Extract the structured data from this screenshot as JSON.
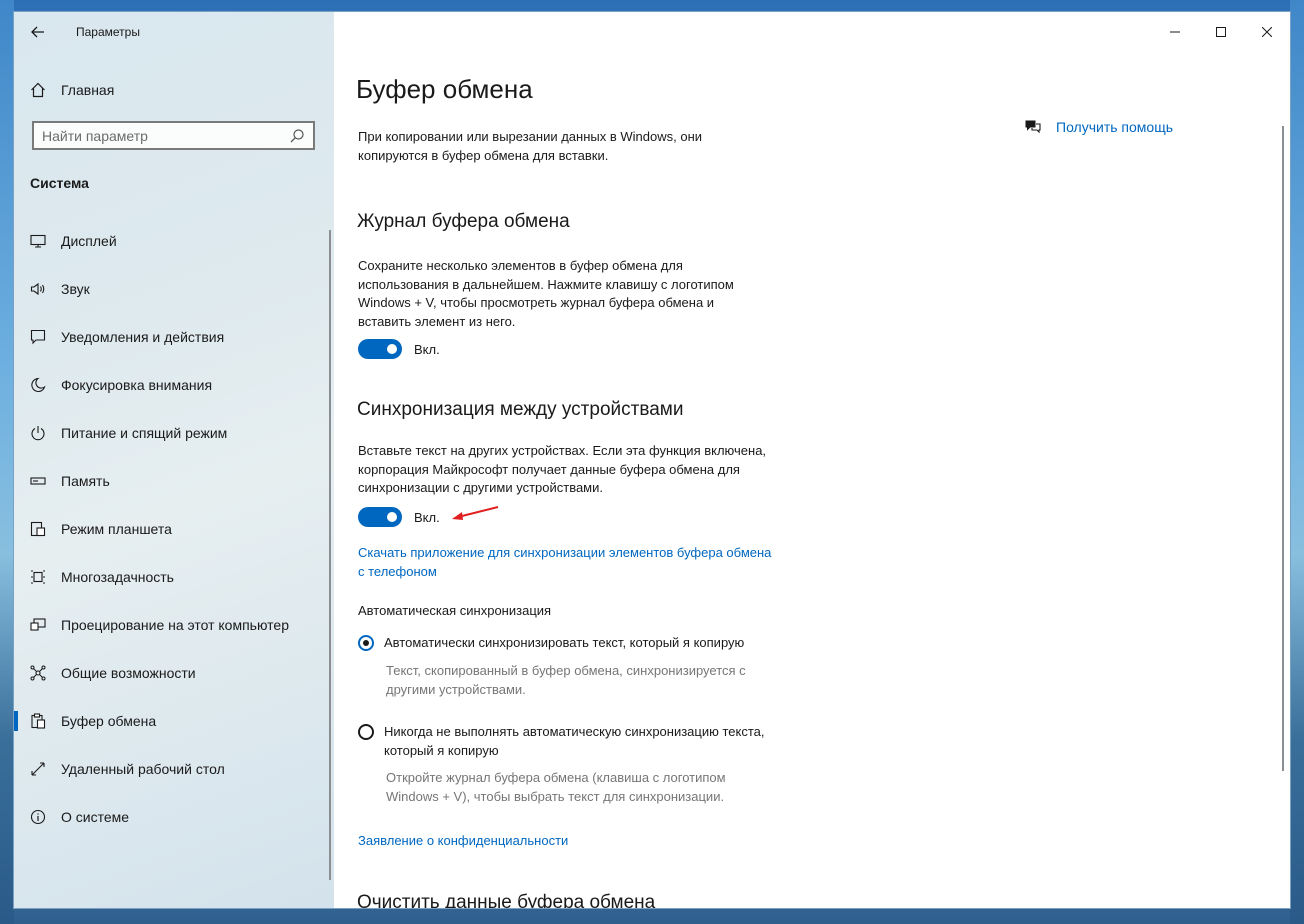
{
  "app": {
    "title": "Параметры"
  },
  "sidebar": {
    "home_label": "Главная",
    "search_placeholder": "Найти параметр",
    "section_label": "Система",
    "items": [
      {
        "label": "Дисплей",
        "icon": "display-icon"
      },
      {
        "label": "Звук",
        "icon": "speaker-icon"
      },
      {
        "label": "Уведомления и действия",
        "icon": "notification-icon"
      },
      {
        "label": "Фокусировка внимания",
        "icon": "moon-icon"
      },
      {
        "label": "Питание и спящий режим",
        "icon": "power-icon"
      },
      {
        "label": "Память",
        "icon": "storage-icon"
      },
      {
        "label": "Режим планшета",
        "icon": "tablet-icon"
      },
      {
        "label": "Многозадачность",
        "icon": "multitask-icon"
      },
      {
        "label": "Проецирование на этот компьютер",
        "icon": "project-icon"
      },
      {
        "label": "Общие возможности",
        "icon": "shared-icon"
      },
      {
        "label": "Буфер обмена",
        "icon": "clipboard-icon",
        "active": true
      },
      {
        "label": "Удаленный рабочий стол",
        "icon": "remote-icon"
      },
      {
        "label": "О системе",
        "icon": "info-icon"
      }
    ]
  },
  "main": {
    "title": "Буфер обмена",
    "help_label": "Получить помощь",
    "intro": [
      "При копировании или вырезании данных в Windows, они",
      "копируются в буфер обмена для вставки."
    ],
    "history": {
      "title": "Журнал буфера обмена",
      "desc": [
        "Сохраните несколько элементов в буфер обмена для",
        "использования в дальнейшем. Нажмите клавишу с логотипом",
        "Windows + V, чтобы просмотреть журнал буфера обмена и",
        "вставить элемент из него."
      ],
      "toggle_label": "Вкл."
    },
    "sync": {
      "title": "Синхронизация между устройствами",
      "desc": [
        "Вставьте текст на других устройствах. Если эта функция включена,",
        "корпорация Майкрософт получает данные буфера обмена для",
        "синхронизации с другими устройствами."
      ],
      "toggle_label": "Вкл.",
      "app_link": [
        "Скачать приложение для синхронизации элементов буфера обмена",
        "с телефоном"
      ],
      "auto_label": "Автоматическая синхронизация",
      "option1": "Автоматически синхронизировать текст, который я копирую",
      "option1_desc": [
        "Текст, скопированный в буфер обмена, синхронизируется с",
        "другими устройствами."
      ],
      "option2": [
        "Никогда не выполнять автоматическую синхронизацию текста,",
        "который я копирую"
      ],
      "option2_desc": [
        "Откройте журнал буфера обмена (клавиша с логотипом",
        "Windows + V), чтобы выбрать текст для синхронизации."
      ]
    },
    "privacy_link": "Заявление о конфиденциальности",
    "clear_title": "Очистить данные буфера обмена"
  },
  "colors": {
    "accent": "#0067c0",
    "annotation_arrow": "#e02020"
  }
}
